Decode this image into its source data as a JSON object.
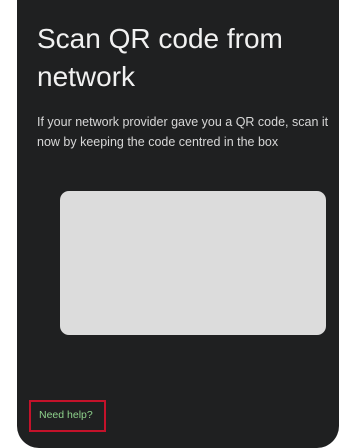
{
  "screen": {
    "title": "Scan QR code from network",
    "description": "If your network provider gave you a QR code, scan it now by keeping the code centred in the box",
    "help_link": "Need help?"
  },
  "colors": {
    "background": "#1f2021",
    "title_text": "#f1f1f1",
    "body_text": "#d7d7d7",
    "scanner_area": "#dcdcdc",
    "link": "#8ed28c",
    "highlight": "#c4122a"
  }
}
